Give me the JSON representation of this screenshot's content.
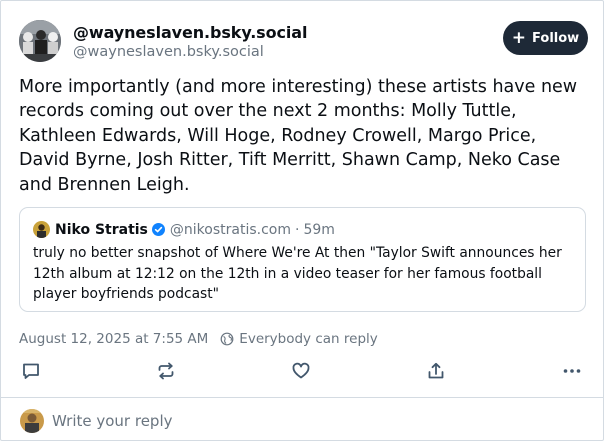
{
  "post": {
    "handle": "@wayneslaven.bsky.social",
    "sub_handle": "@wayneslaven.bsky.social",
    "follow_label": "Follow",
    "text": "More importantly (and more interesting) these artists have new records coming out over the next 2 months: Molly Tuttle, Kathleen Edwards, Will Hoge, Rodney Crowell, Margo Price, David Byrne, Josh Ritter, Tift Merritt, Shawn Camp, Neko Case and Brennen Leigh.",
    "timestamp": "August 12, 2025 at 7:55 AM",
    "reply_setting": "Everybody can reply"
  },
  "quote": {
    "name": "Niko Stratis",
    "handle": "@nikostratis.com",
    "separator": "·",
    "time": "59m",
    "text": "truly no better snapshot of Where We're At then \"Taylor Swift announces her 12th album at 12:12 on the 12th in a video teaser for her famous football player boyfriends podcast\""
  },
  "reply": {
    "placeholder": "Write your reply"
  },
  "icons": {
    "follow": "plus-icon",
    "verified": "verified-badge-icon",
    "reply_setting": "globe-icon",
    "actions": [
      "reply-icon",
      "repost-icon",
      "like-icon",
      "share-icon",
      "more-icon"
    ]
  },
  "colors": {
    "follow_button_bg": "#1e2937",
    "verified": "#1083fe",
    "muted_text": "#6a7580",
    "icon": "#42576c",
    "border": "#d4dbe2"
  }
}
